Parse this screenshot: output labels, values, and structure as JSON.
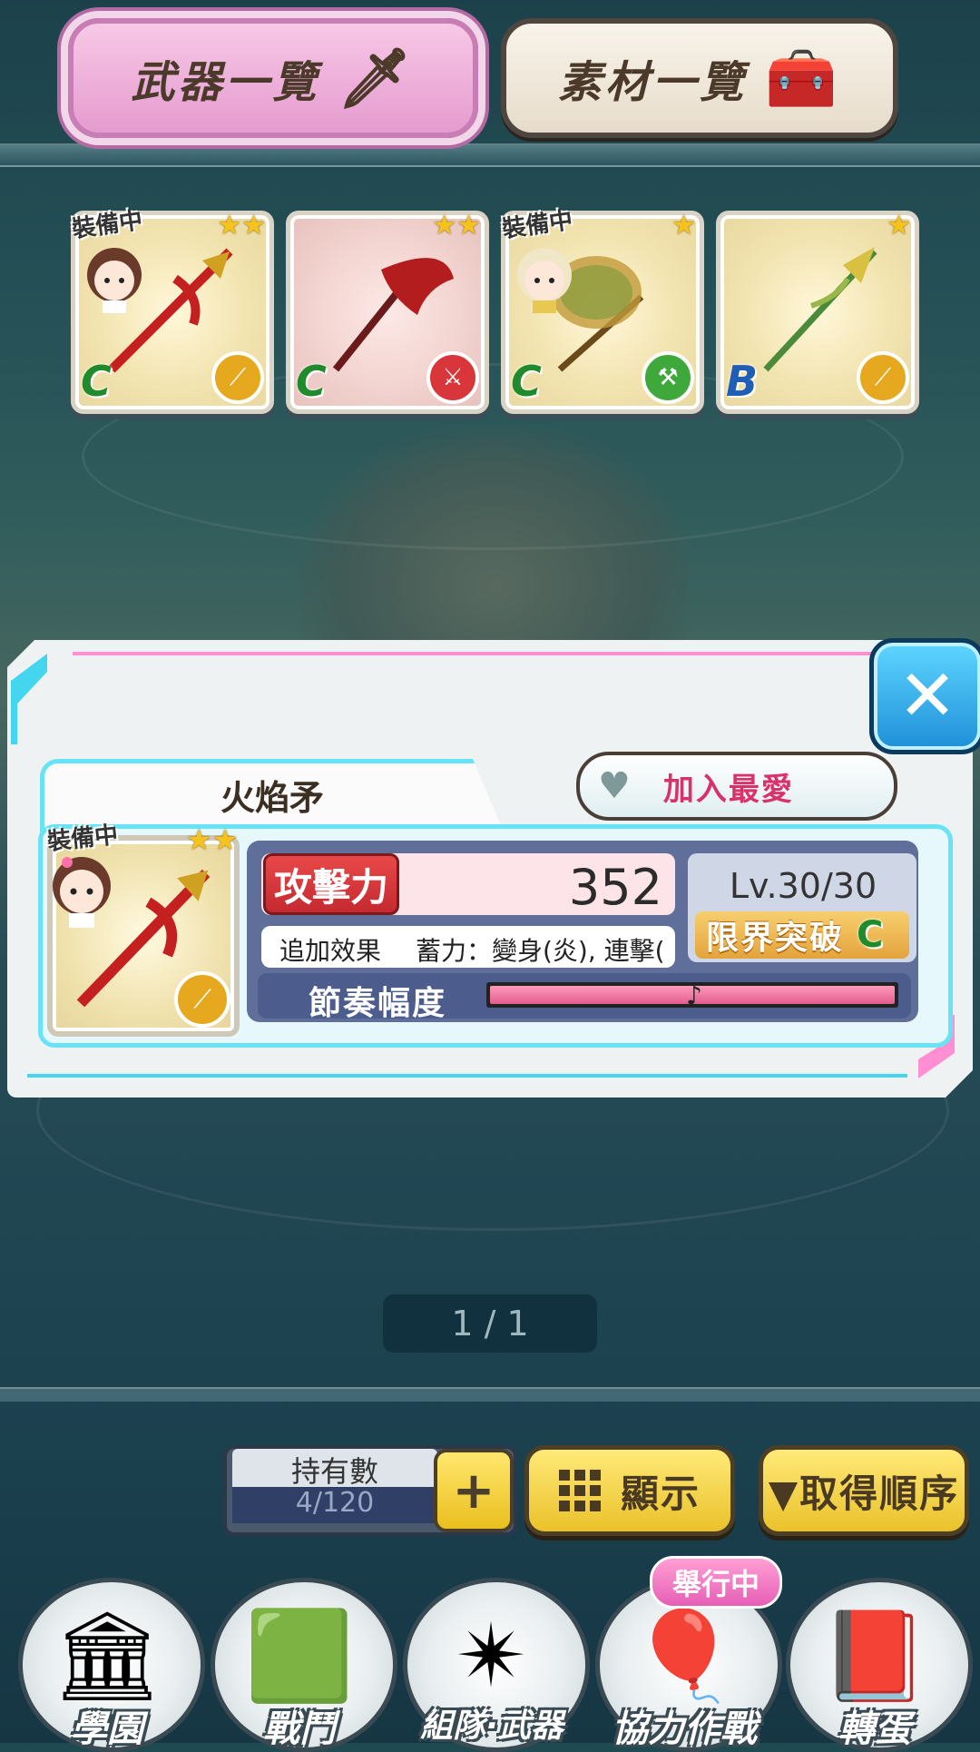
{
  "tabs": {
    "weapons": {
      "label": "武器一覽",
      "icon": "sword-icon"
    },
    "materials": {
      "label": "素材一覽",
      "icon": "treasure-chest-icon"
    }
  },
  "weapon_cards": [
    {
      "stars": "★★",
      "equipped_label": "裝備中",
      "rank": "C",
      "type_icon": "spear-icon",
      "type_color": "#e6a81f",
      "weapon_color": "#c42020"
    },
    {
      "stars": "★★",
      "equipped_label": "",
      "rank": "C",
      "type_icon": "sword-icon",
      "type_color": "#d8363a",
      "weapon_color": "#b31d1d"
    },
    {
      "stars": "★",
      "equipped_label": "裝備中",
      "rank": "C",
      "type_icon": "hammer-icon",
      "type_color": "#3ea83a",
      "weapon_color": "#a87a2a"
    },
    {
      "stars": "★",
      "equipped_label": "",
      "rank": "B",
      "type_icon": "spear-icon",
      "type_color": "#e6a81f",
      "weapon_color": "#9bb74a"
    }
  ],
  "detail": {
    "name": "火焰矛",
    "favorite_label": "加入最愛",
    "equipped_label": "裝備中",
    "stars": "★★",
    "attack_label": "攻擊力",
    "attack_value": "352",
    "level_text": "Lv.30/30",
    "limit_break_label": "限界突破",
    "limit_break_rank": "C",
    "effect_label": "追加效果",
    "effect_text": "蓄力：變身(炎), 連擊(",
    "rhythm_label": "節奏幅度",
    "rhythm_fill": 1.0,
    "close_icon": "close-icon"
  },
  "pagination": {
    "text": "1 / 1"
  },
  "controls": {
    "owned_label": "持有數",
    "owned_value": "4/120",
    "plus_label": "+",
    "display_label": "顯示",
    "sort_label": "▼取得順序"
  },
  "nav": [
    {
      "label": "學園",
      "icon": "school-building-icon"
    },
    {
      "label": "戰鬥",
      "icon": "blackboard-icon"
    },
    {
      "label": "組隊·武器",
      "icon": "compass-star-icon"
    },
    {
      "label": "協力作戰",
      "icon": "balloons-icon",
      "badge": "舉行中"
    },
    {
      "label": "轉蛋",
      "icon": "gacha-ticket-icon"
    }
  ]
}
